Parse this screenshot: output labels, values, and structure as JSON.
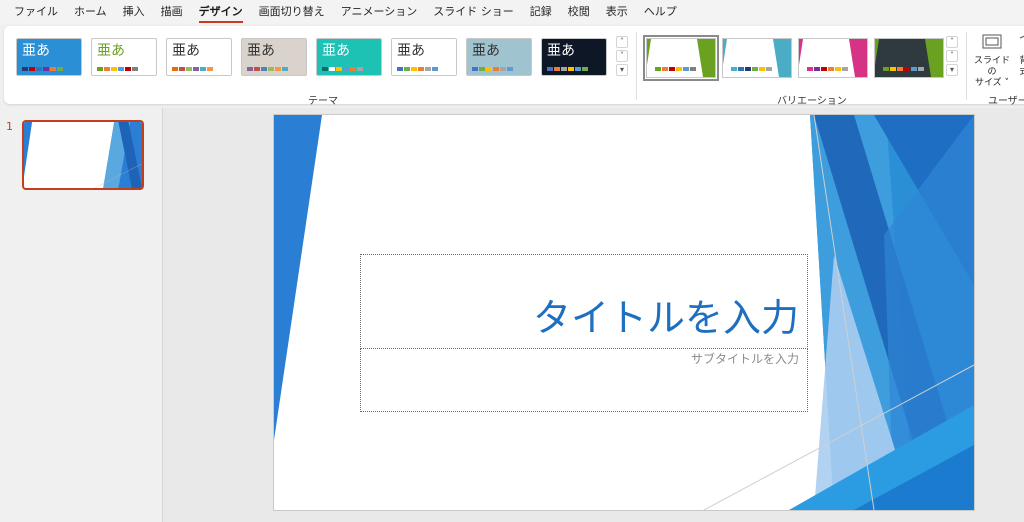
{
  "menu": {
    "items": [
      "ファイル",
      "ホーム",
      "挿入",
      "描画",
      "デザイン",
      "画面切り替え",
      "アニメーション",
      "スライド ショー",
      "記録",
      "校閲",
      "表示",
      "ヘルプ"
    ],
    "active": "デザイン"
  },
  "ribbon": {
    "themes_label": "テーマ",
    "variations_label": "バリエーション",
    "customize_label": "ユーザー設",
    "theme_sample_text": "亜あ",
    "slide_size_label_line1": "スライドの",
    "slide_size_label_line2": "サイズ",
    "background_label_line1": "背",
    "background_label_line2": "式"
  },
  "themes": [
    {
      "bg": "#2b8fd6",
      "text": "#ffffff",
      "swatches": [
        "#1f3b73",
        "#c00000",
        "#2e75b6",
        "#7030a0",
        "#ed7d31",
        "#70ad47"
      ]
    },
    {
      "bg": "#ffffff",
      "text": "#6aa121",
      "swatches": [
        "#6aa121",
        "#ed7d31",
        "#ffc000",
        "#5b9bd5",
        "#c00000",
        "#7f7f7f"
      ]
    },
    {
      "bg": "#ffffff",
      "text": "#333333",
      "swatches": [
        "#e46c0a",
        "#c0504d",
        "#9bbb59",
        "#8064a2",
        "#4bacc6",
        "#f79646"
      ]
    },
    {
      "bg": "#d9d3cc",
      "text": "#333333",
      "swatches": [
        "#8064a2",
        "#c0504d",
        "#4f81bd",
        "#9bbb59",
        "#f79646",
        "#4bacc6"
      ]
    },
    {
      "bg": "#1ec2b5",
      "text": "#ffffff",
      "swatches": [
        "#0f6b63",
        "#ffffff",
        "#ffc000",
        "#5b9bd5",
        "#ed7d31",
        "#a5a5a5"
      ]
    },
    {
      "bg": "#ffffff",
      "text": "#333333",
      "swatches": [
        "#4472c4",
        "#70ad47",
        "#ffc000",
        "#ed7d31",
        "#a5a5a5",
        "#5b9bd5"
      ]
    },
    {
      "bg": "#9fc3cf",
      "text": "#333333",
      "swatches": [
        "#4472c4",
        "#70ad47",
        "#ffc000",
        "#ed7d31",
        "#a5a5a5",
        "#5b9bd5"
      ]
    },
    {
      "bg": "#0e1726",
      "text": "#ffffff",
      "swatches": [
        "#4472c4",
        "#ed7d31",
        "#a5a5a5",
        "#ffc000",
        "#5b9bd5",
        "#70ad47"
      ]
    }
  ],
  "variations": [
    {
      "bg": "#ffffff",
      "accent": "#6aa121",
      "swatches": [
        "#6aa121",
        "#ed7d31",
        "#c00000",
        "#ffc000",
        "#5b9bd5",
        "#7f7f7f"
      ]
    },
    {
      "bg": "#ffffff",
      "accent": "#4bacc6",
      "swatches": [
        "#4bacc6",
        "#2e75b6",
        "#1f3b73",
        "#70ad47",
        "#ffc000",
        "#a5a5a5"
      ]
    },
    {
      "bg": "#ffffff",
      "accent": "#d63384",
      "swatches": [
        "#d63384",
        "#7030a0",
        "#c00000",
        "#ed7d31",
        "#ffc000",
        "#a5a5a5"
      ]
    },
    {
      "bg": "#2f3a3f",
      "accent": "#6aa121",
      "swatches": [
        "#6aa121",
        "#ffc000",
        "#ed7d31",
        "#c00000",
        "#5b9bd5",
        "#a5a5a5"
      ]
    }
  ],
  "slides_pane": {
    "slide_number": "1"
  },
  "slide": {
    "title": "タイトルを入力",
    "subtitle": "サブタイトルを入力"
  },
  "colors": {
    "accent": "#c43e1c",
    "title_blue": "#1f6fc1"
  }
}
